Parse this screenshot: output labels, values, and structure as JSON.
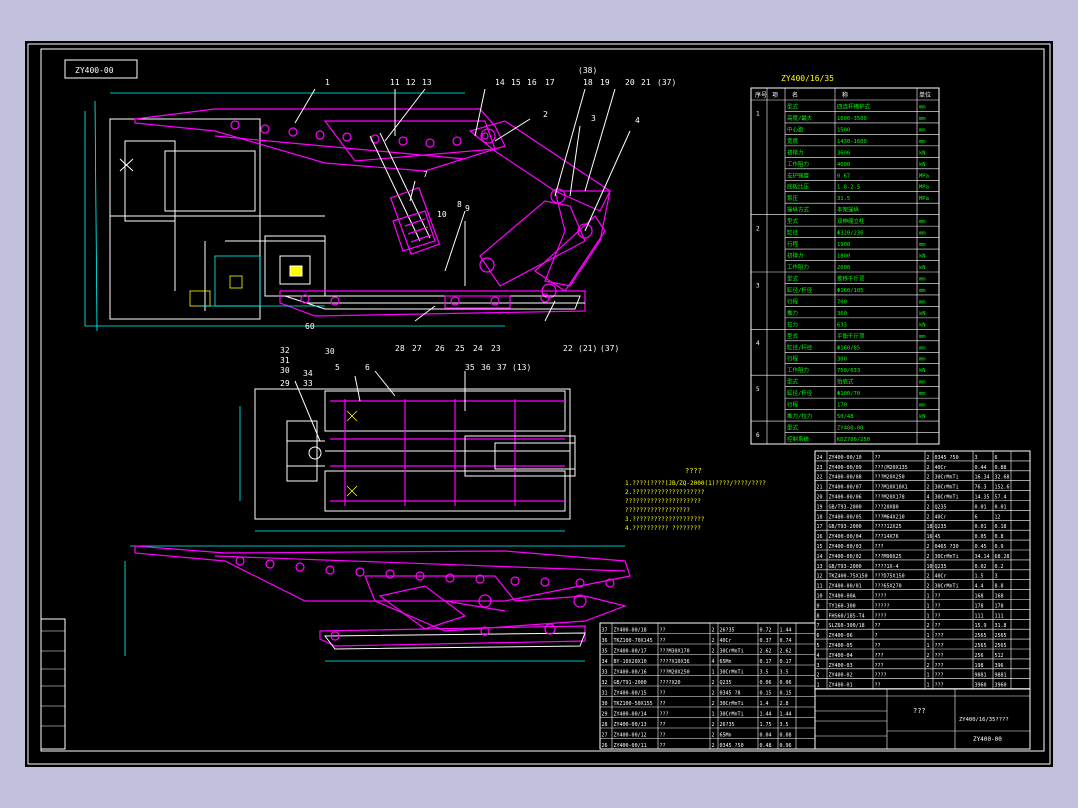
{
  "drawing": {
    "code_box": "ZY400-00",
    "spec_title": "ZY400/16/35",
    "spec_header": [
      "序号",
      "项",
      "名",
      "称",
      "单位"
    ],
    "callouts_top": [
      "1",
      "11",
      "12",
      "13",
      "14",
      "15",
      "16",
      "17",
      "(38)",
      "18",
      "19",
      "20",
      "21",
      "(37)",
      "2",
      "3",
      "4",
      "7",
      "8",
      "9",
      "10",
      "5",
      "6"
    ],
    "callouts_bottom": [
      "28",
      "27",
      "26",
      "25",
      "24",
      "23",
      "22",
      "(21)",
      "(37)"
    ],
    "callouts_plan": [
      "32",
      "31",
      "30",
      "29",
      "34",
      "33",
      "5",
      "6",
      "35",
      "36",
      "37",
      "(13)"
    ],
    "note_title": "????",
    "notes": [
      "1.????(????)JB/ZQ-2000(1)????/????/????",
      "2.????????????????????",
      "  ?????????????????????",
      "  ??????????????????",
      "3.????????????????????",
      "4.?????????? ????????"
    ],
    "center_label": "???",
    "drawing_name": "ZY400/16/35????",
    "drawing_no": "ZY400-00"
  },
  "bom_right": [
    [
      "24",
      "ZY400-00/10",
      "??",
      "2",
      "0345 ?50",
      "3",
      "6"
    ],
    [
      "23",
      "ZY400-00/09",
      "???(M20X135",
      "2",
      "40Cr",
      "0.44",
      "0.88"
    ],
    [
      "22",
      "ZY400-00/08",
      "???M20X250",
      "2",
      "30CrMnTi",
      "16.34",
      "32.68"
    ],
    [
      "21",
      "ZY400-00/07",
      "???M10X10X1",
      "2",
      "30CrMnTi",
      "76.3",
      "152.6"
    ],
    [
      "20",
      "ZY400-00/06",
      "???M20X178",
      "4",
      "30CrMnTi",
      "14.35",
      "57.4"
    ],
    [
      "19",
      "GB/T93-2000",
      "???20X80",
      "2",
      "Q235",
      "0.01",
      "0.01"
    ],
    [
      "18",
      "ZY400-00/05",
      "???M64X210",
      "2",
      "40Cr",
      "6",
      "12"
    ],
    [
      "17",
      "GB/T93-2000",
      "????12X25",
      "18",
      "Q235",
      "0.01",
      "0.18"
    ],
    [
      "16",
      "ZY400-00/04",
      "???14X76",
      "16",
      "45",
      "0.05",
      "0.8"
    ],
    [
      "15",
      "ZY400-00/03",
      "???",
      "2",
      "0465 ?30",
      "0.45",
      "0.9"
    ],
    [
      "14",
      "ZY400-00/02",
      "???M90X25",
      "2",
      "30CrMnTi",
      "34.14",
      "68.28"
    ],
    [
      "13",
      "GB/T93-2000",
      "????1X-4",
      "10",
      "Q235",
      "0.02",
      "0.2"
    ],
    [
      "12",
      "TKZ400-75X150",
      "???D75X150",
      "2",
      "40Cr",
      "1.5",
      "3"
    ],
    [
      "11",
      "ZY400-00/01",
      "???65X270",
      "2",
      "30CrMnTi",
      "4.4",
      "8.8"
    ],
    [
      "10",
      "ZY400-00A",
      "????",
      "1",
      "??",
      "168",
      "168"
    ],
    [
      "9",
      "TY160-300",
      "?????",
      "1",
      "??",
      "178",
      "178"
    ],
    [
      "8",
      "FHS60/185-T4",
      "????",
      "1",
      "??",
      "111",
      "111"
    ],
    [
      "7",
      "SLZ60-300/18",
      "??",
      "2",
      "??",
      "15.9",
      "31.8"
    ],
    [
      "6",
      "ZY400-06",
      "?",
      "1",
      "???",
      "2565",
      "2565"
    ],
    [
      "5",
      "ZY400-05",
      "??",
      "1",
      "???",
      "2565",
      "2565"
    ],
    [
      "4",
      "ZY400-04",
      "???",
      "2",
      "???",
      "256",
      "512"
    ],
    [
      "3",
      "ZY400-03",
      "???",
      "2",
      "???",
      "198",
      "396"
    ],
    [
      "2",
      "ZY400-02",
      "????",
      "1",
      "???",
      "9881",
      "9881"
    ],
    [
      "1",
      "ZY400-01",
      "??",
      "1",
      "???",
      "3960",
      "3960"
    ]
  ],
  "bom_left": [
    [
      "37",
      "ZY400-00/18",
      "??",
      "2",
      "26?35",
      "0.72",
      "1.44"
    ],
    [
      "36",
      "TKZ100-70X145",
      "??",
      "2",
      "40Cr",
      "0.37",
      "0.74"
    ],
    [
      "35",
      "ZY400-00/17",
      "???M30X170",
      "2",
      "30CrMnTi",
      "2.62",
      "2.62"
    ],
    [
      "34",
      "BY-10X20X10",
      "????X10X36",
      "4",
      "65Mn",
      "0.17",
      "0.17"
    ],
    [
      "33",
      "ZY400-00/16",
      "???M20X250",
      "1",
      "30CrMnTi",
      "3.5",
      "3.5"
    ],
    [
      "32",
      "GB/T91-2000",
      "????X20",
      "2",
      "Q235",
      "0.06",
      "0.06"
    ],
    [
      "31",
      "ZY400-00/15",
      "??",
      "2",
      "0345 ?8",
      "0.15",
      "0.15"
    ],
    [
      "30",
      "TKZ100-50X155",
      "??",
      "2",
      "30CrMnTi",
      "1.4",
      "2.8"
    ],
    [
      "29",
      "ZY400-00/14",
      "???",
      "1",
      "30CrMnTi",
      "1.44",
      "1.44"
    ],
    [
      "28",
      "ZY400-00/13",
      "??",
      "2",
      "26?35",
      "1.75",
      "3.5"
    ],
    [
      "27",
      "ZY400-00/12",
      "??",
      "2",
      "65Mn",
      "0.04",
      "0.08"
    ],
    [
      "26",
      "ZY400-00/11",
      "??",
      "2",
      "0345 ?50",
      "0.48",
      "0.96"
    ]
  ],
  "spec_rows": [
    {
      "group": "1",
      "label": "型式",
      "value": "四连杆掩护式",
      "unit": "mm"
    },
    {
      "group": "1",
      "label": "高度/最大",
      "value": "1600-3500",
      "unit": "mm"
    },
    {
      "group": "1",
      "label": "中心距",
      "value": "1500",
      "unit": "mm"
    },
    {
      "group": "1",
      "label": "宽度",
      "value": "1430-1600",
      "unit": "mm"
    },
    {
      "group": "1",
      "label": "初撑力",
      "value": "3600",
      "unit": "kN"
    },
    {
      "group": "1",
      "label": "工作阻力",
      "value": "4000",
      "unit": "kN"
    },
    {
      "group": "1",
      "label": "支护强度",
      "value": "0.67",
      "unit": "MPa"
    },
    {
      "group": "1",
      "label": "底板比压",
      "value": "1.8-2.5",
      "unit": "MPa"
    },
    {
      "group": "1",
      "label": "泵压",
      "value": "31.5",
      "unit": "MPa"
    },
    {
      "group": "1",
      "label": "操纵方式",
      "value": "本架操纵",
      "unit": ""
    },
    {
      "group": "2",
      "label": "型式",
      "value": "双伸缩立柱",
      "unit": "mm"
    },
    {
      "group": "2",
      "label": "缸径",
      "value": "Φ320/230",
      "unit": "mm"
    },
    {
      "group": "2",
      "label": "行程",
      "value": "1900",
      "unit": "mm"
    },
    {
      "group": "2",
      "label": "初撑力",
      "value": "1800",
      "unit": "kN"
    },
    {
      "group": "2",
      "label": "工作阻力",
      "value": "2000",
      "unit": "kN"
    },
    {
      "group": "3",
      "label": "型式",
      "value": "推移千斤顶",
      "unit": "mm"
    },
    {
      "group": "3",
      "label": "缸径/杆径",
      "value": "Φ160/105",
      "unit": "mm"
    },
    {
      "group": "3",
      "label": "行程",
      "value": "700",
      "unit": "mm"
    },
    {
      "group": "3",
      "label": "推力",
      "value": "360",
      "unit": "kN"
    },
    {
      "group": "3",
      "label": "拉力",
      "value": "633",
      "unit": "kN"
    },
    {
      "group": "4",
      "label": "型式",
      "value": "平衡千斤顶",
      "unit": "mm"
    },
    {
      "group": "4",
      "label": "缸径/杆径",
      "value": "Φ160/85",
      "unit": "mm"
    },
    {
      "group": "4",
      "label": "行程",
      "value": "300",
      "unit": "mm"
    },
    {
      "group": "4",
      "label": "工作阻力",
      "value": "750/633",
      "unit": "kN"
    },
    {
      "group": "5",
      "label": "型式",
      "value": "抬底式",
      "unit": "mm"
    },
    {
      "group": "5",
      "label": "缸径/杆径",
      "value": "Φ100/70",
      "unit": "mm"
    },
    {
      "group": "5",
      "label": "行程",
      "value": "170",
      "unit": "mm"
    },
    {
      "group": "5",
      "label": "推力/拉力",
      "value": "50/48",
      "unit": "kN"
    },
    {
      "group": "6",
      "label": "型式",
      "value": "ZY400-00",
      "unit": ""
    },
    {
      "group": "6",
      "label": "控制系统",
      "value": "KDZ700/250",
      "unit": ""
    }
  ],
  "colors": {
    "background": "#000000",
    "outline": "#ffffff",
    "frame": "#ff00ff",
    "dims": "#00ffff",
    "notes": "#ffff00",
    "table": "#00ff00"
  }
}
